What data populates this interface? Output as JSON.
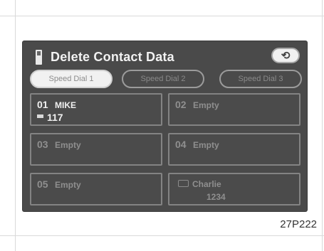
{
  "screen": {
    "title": "Delete Contact Data",
    "back_icon_glyph": "⟲"
  },
  "tabs": [
    {
      "label": "Speed Dial 1",
      "active": true
    },
    {
      "label": "Speed Dial 2",
      "active": false
    },
    {
      "label": "Speed Dial 3",
      "active": false
    }
  ],
  "entries": [
    {
      "number": "01",
      "name": "MIKE",
      "phone": "117",
      "filled": true
    },
    {
      "number": "02",
      "name": "Empty",
      "filled": false
    },
    {
      "number": "03",
      "name": "Empty",
      "filled": false
    },
    {
      "number": "04",
      "name": "Empty",
      "filled": false
    },
    {
      "number": "05",
      "name": "Empty",
      "filled": false
    },
    {
      "number": "",
      "name": "Charlie",
      "phone": "1234",
      "filled": true,
      "contact_icon": true
    }
  ],
  "figure_code": "27P222"
}
